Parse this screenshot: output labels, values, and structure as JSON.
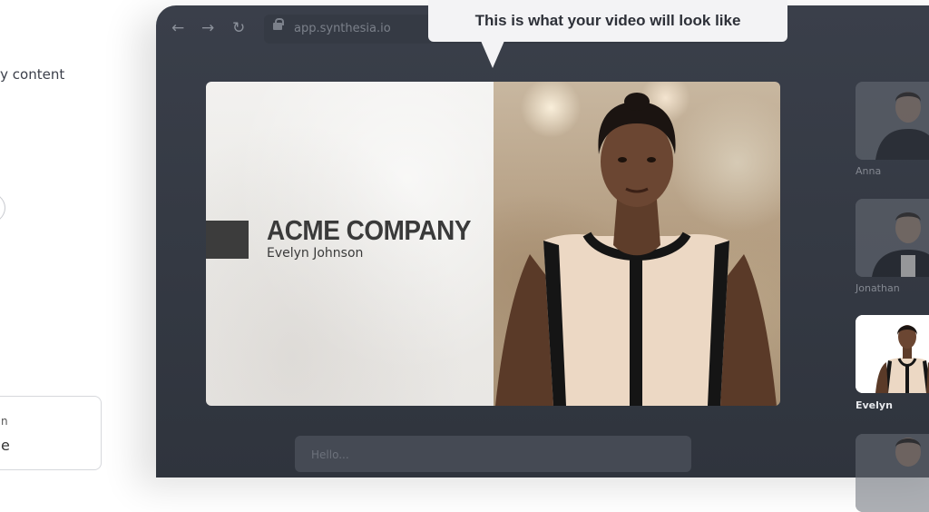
{
  "page": {
    "left_text": "ry content",
    "left_card": {
      "line1": "n",
      "line2": "e"
    }
  },
  "browser": {
    "url": "app.synthesia.io",
    "nav_icons": [
      "back-arrow-icon",
      "forward-arrow-icon",
      "reload-icon",
      "lock-icon"
    ]
  },
  "tooltip": {
    "text": "This is what your video will look like"
  },
  "video": {
    "company": "ACME COMPANY",
    "person": "Evelyn Johnson"
  },
  "avatars": [
    {
      "name": "Anna",
      "selected": false
    },
    {
      "name": "Jonathan",
      "selected": false
    },
    {
      "name": "Evelyn",
      "selected": true
    },
    {
      "name": "",
      "selected": false
    }
  ],
  "script_input": {
    "placeholder": "Hello..."
  },
  "colors": {
    "browser_bg": "#343943",
    "tooltip_bg": "#f3f3f5",
    "accent_block": "#3c3c3c"
  }
}
